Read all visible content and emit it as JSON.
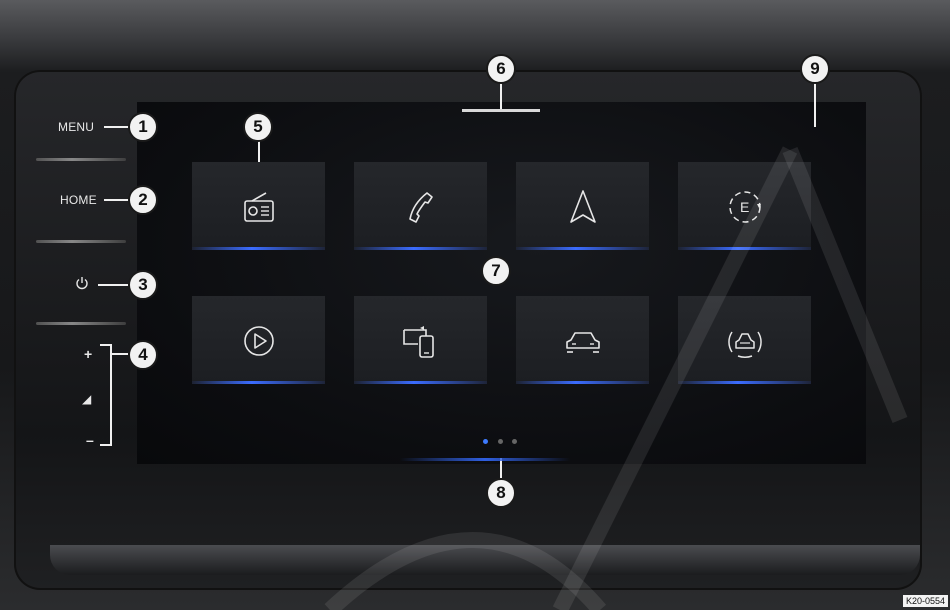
{
  "hardware": {
    "menu_label": "MENU",
    "home_label": "HOME",
    "power_icon": "power-icon",
    "volume_up": "+",
    "volume_level": "◢",
    "volume_down": "–"
  },
  "callouts": [
    "1",
    "2",
    "3",
    "4",
    "5",
    "6",
    "7",
    "8",
    "9"
  ],
  "tiles": [
    {
      "icon": "radio-icon"
    },
    {
      "icon": "phone-icon"
    },
    {
      "icon": "navigation-icon"
    },
    {
      "icon": "e-manager-icon"
    },
    {
      "icon": "media-play-icon"
    },
    {
      "icon": "app-connect-icon"
    },
    {
      "icon": "vehicle-icon"
    },
    {
      "icon": "driver-assist-icon"
    }
  ],
  "pagination": {
    "pages": 3,
    "current": 1
  },
  "image_code": "K20-0554",
  "colors": {
    "accent": "#3b6cff",
    "screen": "#0c0d10",
    "callout_fill": "#f2f2f2"
  }
}
